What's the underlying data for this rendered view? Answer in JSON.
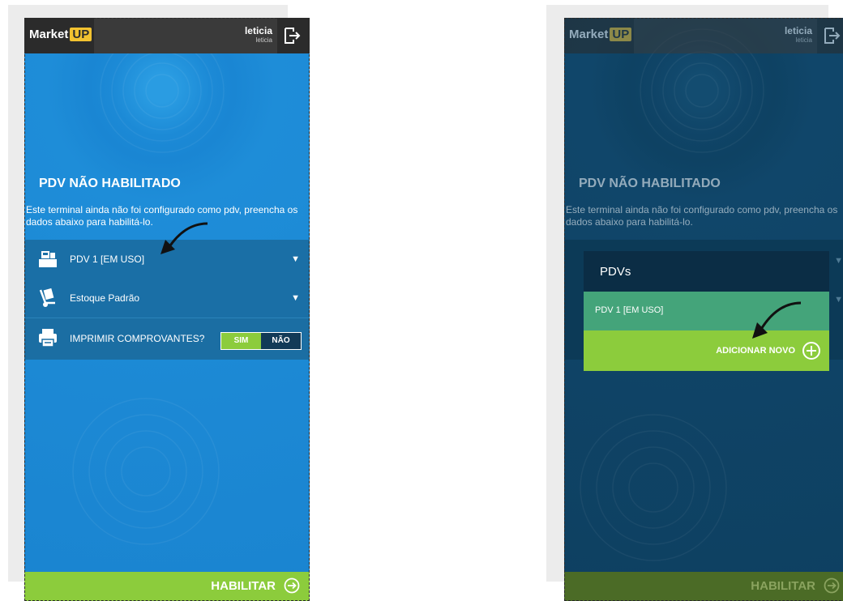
{
  "brand": {
    "name": "Market",
    "accent": "UP"
  },
  "user": {
    "name": "leticia",
    "subtitle": "leticia"
  },
  "page": {
    "title": "PDV NÃO HABILITADO",
    "description": "Este terminal ainda não foi configurado como pdv, preencha os dados abaixo para habilitá-lo."
  },
  "rows": {
    "pdv": "PDV 1 [EM USO]",
    "estoque": "Estoque Padrão",
    "imprimir": "IMPRIMIR COMPROVANTES?",
    "sim": "SIM",
    "nao": "NÃO"
  },
  "action": {
    "habilitar": "HABILITAR"
  },
  "popup": {
    "title": "PDVs",
    "item": "PDV 1 [EM USO]",
    "add": "ADICIONAR NOVO"
  },
  "colors": {
    "blue": "#1a86d3",
    "green": "#8ccc3c",
    "dark": "#0e4263",
    "teal": "#44a47a"
  },
  "icons": [
    "logout-icon",
    "cash-register-icon",
    "hand-truck-icon",
    "printer-icon",
    "chevron-down-icon",
    "arrow-right-circle-icon",
    "plus-circle-icon",
    "pointer-arrow-icon"
  ]
}
